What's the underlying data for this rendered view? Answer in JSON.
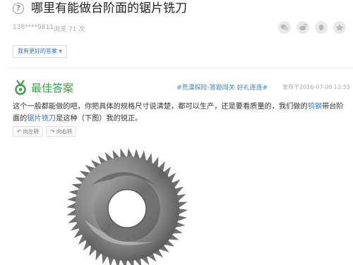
{
  "question": {
    "icon": "question-circle-icon",
    "title": "哪里有能做台阶面的锯片铣刀",
    "user": "138****9811",
    "separator": "|",
    "views": "浏览 71 次"
  },
  "share_icons": [
    "wechat-icon",
    "weibo-icon",
    "qq-icon",
    "qzone-icon"
  ],
  "better_answer_button": "我有更好的答案",
  "best_answer": {
    "icon": "medal-icon",
    "label": "最佳答案",
    "tags": "#荒漠探险-答题闯关 好礼连连#",
    "date": "发布于2016-07-09 12:55",
    "text_part1": "这个一般都能做的吧，你把具体的规格尺寸说清楚，都可以生产，还是要看质量的，我们做的",
    "link1": "钨钢",
    "text_part2": "带台阶面的",
    "link2": "锯片铣刀",
    "text_part3": "是这种（下图）我的锐正。"
  },
  "rotate": {
    "left": "↶ 向左转",
    "right": "↷ 向右转"
  },
  "colors": {
    "accent_green": "#3a9e4a",
    "link_blue": "#3b73c8",
    "tag_blue": "#3b85c6"
  }
}
